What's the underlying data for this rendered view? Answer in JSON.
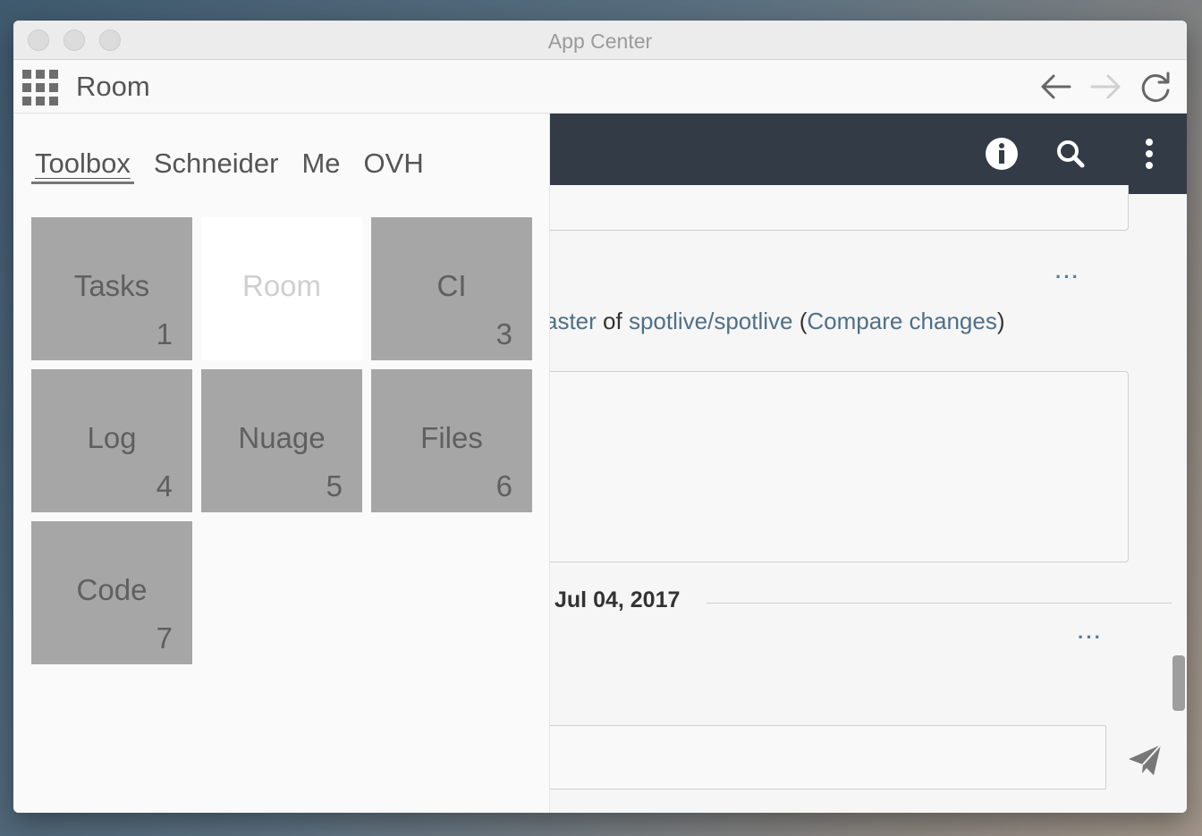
{
  "window": {
    "title": "App Center"
  },
  "navbar": {
    "title": "Room"
  },
  "panel": {
    "tabs": [
      {
        "label": "Toolbox",
        "active": true
      },
      {
        "label": "Schneider"
      },
      {
        "label": "Me"
      },
      {
        "label": "OVH"
      }
    ],
    "tiles": [
      {
        "label": "Tasks",
        "number": "1"
      },
      {
        "label": "Room",
        "number": "",
        "active": true
      },
      {
        "label": "CI",
        "number": "3"
      },
      {
        "label": "Log",
        "number": "4"
      },
      {
        "label": "Nuage",
        "number": "5"
      },
      {
        "label": "Files",
        "number": "6"
      },
      {
        "label": "Code",
        "number": "7"
      }
    ]
  },
  "chat": {
    "message": {
      "prefix": "aster",
      "of": " of ",
      "repo": "spotlive/spotlive",
      "open": " (",
      "compare": "Compare changes",
      "close": ")"
    },
    "date": "Jul 04, 2017",
    "more_label": "···"
  },
  "colors": {
    "header_bg": "#333b47",
    "tile_bg": "#a6a6a6",
    "link": "#4f6f88"
  }
}
